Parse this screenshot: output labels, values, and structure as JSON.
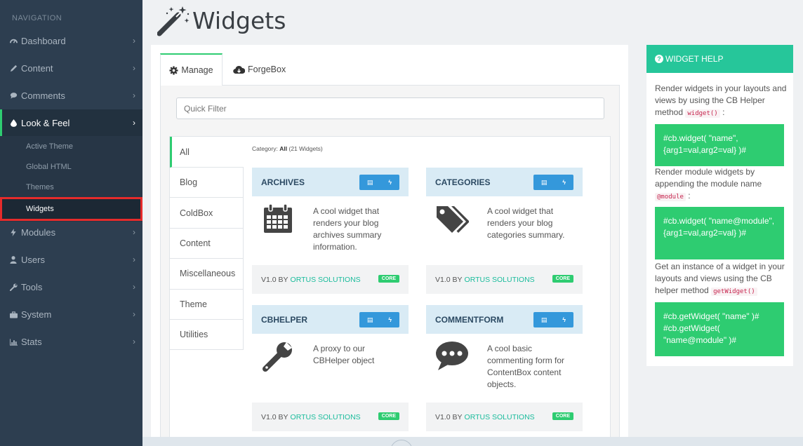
{
  "sidebar": {
    "heading": "NAVIGATION",
    "items": [
      {
        "label": "Dashboard",
        "icon": "dashboard-icon"
      },
      {
        "label": "Content",
        "icon": "pencil-icon"
      },
      {
        "label": "Comments",
        "icon": "comment-icon"
      },
      {
        "label": "Look & Feel",
        "icon": "tint-icon"
      },
      {
        "label": "Modules",
        "icon": "bolt-icon"
      },
      {
        "label": "Users",
        "icon": "user-icon"
      },
      {
        "label": "Tools",
        "icon": "wrench-icon"
      },
      {
        "label": "System",
        "icon": "briefcase-icon"
      },
      {
        "label": "Stats",
        "icon": "bar-chart-icon"
      }
    ],
    "subitems": [
      "Active Theme",
      "Global HTML",
      "Themes",
      "Widgets"
    ]
  },
  "page": {
    "title": "Widgets"
  },
  "tabs": {
    "manage": "Manage",
    "forgebox": "ForgeBox"
  },
  "filter": {
    "placeholder": "Quick Filter"
  },
  "categories": [
    "All",
    "Blog",
    "ColdBox",
    "Content",
    "Miscellaneous",
    "Theme",
    "Utilities"
  ],
  "category_header": {
    "prefix": "Category:",
    "name": "All",
    "count": "(21 Widgets)"
  },
  "widgets": [
    {
      "name": "ARCHIVES",
      "description": "A cool widget that renders your blog archives summary information.",
      "version": "V1.0 BY",
      "author": "ORTUS SOLUTIONS",
      "badge": "CORE",
      "icon": "calendar-icon"
    },
    {
      "name": "CATEGORIES",
      "description": "A cool widget that renders your blog categories summary.",
      "version": "V1.0 BY",
      "author": "ORTUS SOLUTIONS",
      "badge": "CORE",
      "icon": "tags-icon"
    },
    {
      "name": "CBHELPER",
      "description": "A proxy to our CBHelper object",
      "version": "V1.0 BY",
      "author": "ORTUS SOLUTIONS",
      "badge": "CORE",
      "icon": "wrench-icon"
    },
    {
      "name": "COMMENTFORM",
      "description": "A cool basic commenting form for ContentBox content objects.",
      "version": "V1.0 BY",
      "author": "ORTUS SOLUTIONS",
      "badge": "CORE",
      "icon": "comment-icon"
    }
  ],
  "help": {
    "title": "WIDGET HELP",
    "text1": "Render widgets in your layouts and views by using the CB Helper method",
    "code1": "widget()",
    "code_block1": "#cb.widget( \"name\", {arg1=val,arg2=val} )#",
    "text2": "Render module widgets by appending the module name",
    "code2": "@module",
    "code_block2": "#cb.widget( \"name@module\", {arg1=val,arg2=val} )#",
    "text3": "Get an instance of a widget in your layouts and views using the CB helper method",
    "code3": "getWidget()",
    "code_block3": "#cb.getWidget( \"name\" )# #cb.getWidget( \"name@module\" )#"
  },
  "colors": {
    "sidebar": "#2d3e50",
    "accent": "#2ecc71",
    "card_head": "#d9ebf5",
    "button": "#3498db",
    "selection": "#e52b2b"
  }
}
